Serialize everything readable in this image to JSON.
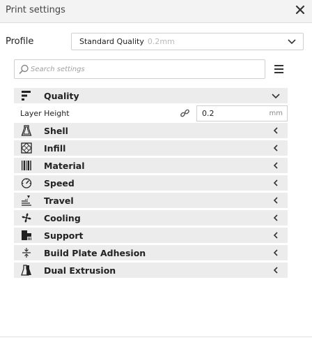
{
  "header": {
    "title": "Print settings",
    "close_icon": "close-icon"
  },
  "profile": {
    "label": "Profile",
    "value": "Standard Quality",
    "detail": "0.2mm"
  },
  "search": {
    "placeholder": "Search settings",
    "value": ""
  },
  "categories": [
    {
      "label": "Quality",
      "icon": "quality-icon",
      "expanded": true
    },
    {
      "label": "Shell",
      "icon": "shell-icon",
      "expanded": false
    },
    {
      "label": "Infill",
      "icon": "infill-icon",
      "expanded": false
    },
    {
      "label": "Material",
      "icon": "material-icon",
      "expanded": false
    },
    {
      "label": "Speed",
      "icon": "speed-icon",
      "expanded": false
    },
    {
      "label": "Travel",
      "icon": "travel-icon",
      "expanded": false
    },
    {
      "label": "Cooling",
      "icon": "cooling-icon",
      "expanded": false
    },
    {
      "label": "Support",
      "icon": "support-icon",
      "expanded": false
    },
    {
      "label": "Build Plate Adhesion",
      "icon": "build-plate-adhesion-icon",
      "expanded": false
    },
    {
      "label": "Dual Extrusion",
      "icon": "dual-extrusion-icon",
      "expanded": false
    }
  ],
  "settings": {
    "layer_height": {
      "label": "Layer Height",
      "value": "0.2",
      "unit": "mm"
    }
  },
  "colors": {
    "row_bg": "#ececec",
    "border": "#cfcfcf",
    "text": "#222222",
    "muted": "#b8b8b8"
  }
}
